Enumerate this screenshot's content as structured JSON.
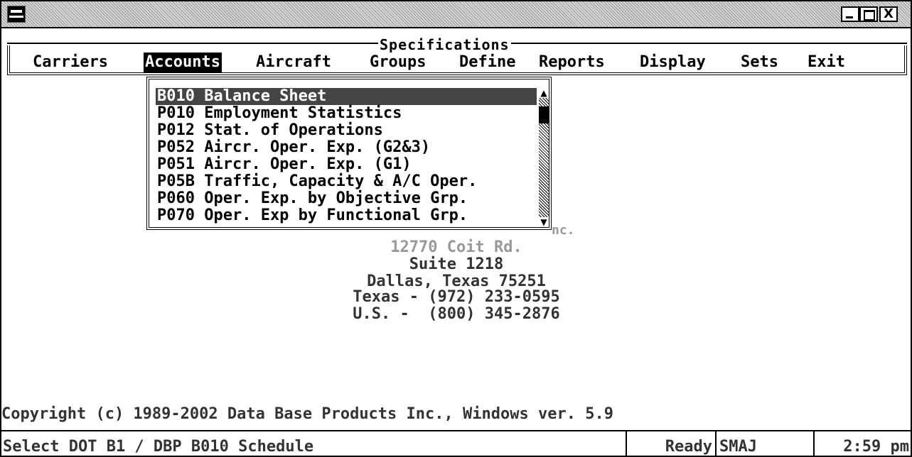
{
  "window": {
    "icon": "app-window-icon",
    "controls": [
      "minimize-icon",
      "maximize-icon",
      "close-icon"
    ],
    "close_glyph": "X"
  },
  "menu": {
    "title": "Specifications",
    "items": [
      "Carriers",
      "Accounts",
      "Aircraft",
      "Groups",
      "Define",
      "Reports",
      "Display",
      "Sets",
      "Exit"
    ],
    "active": "Accounts"
  },
  "dropdown": {
    "items": [
      "B010 Balance Sheet",
      "P010 Employment Statistics",
      "P012 Stat. of Operations",
      "P052 Aircr. Oper. Exp. (G2&3)",
      "P051 Aircr. Oper. Exp. (G1)",
      "P05B Traffic, Capacity & A/C Oper.",
      "P060 Oper. Exp. by Objective Grp.",
      "P070 Oper. Exp by Functional Grp."
    ],
    "selected_index": 0,
    "scroll_up": "▲",
    "scroll_down": "▼"
  },
  "company": {
    "suffix_fragment": "nc.",
    "address": "12770 Coit Rd.",
    "suite": "Suite 1218",
    "city": "Dallas, Texas 75251",
    "phone_texas": "Texas - (972) 233-0595",
    "phone_us": "U.S. -  (800) 345-2876"
  },
  "copyright": "Copyright (c) 1989-2002 Data Base Products Inc., Windows ver. 5.9",
  "status": {
    "message": "Select DOT B1 / DBP B010 Schedule",
    "state": "Ready",
    "user": "SMAJ",
    "time": "2:59 pm"
  }
}
